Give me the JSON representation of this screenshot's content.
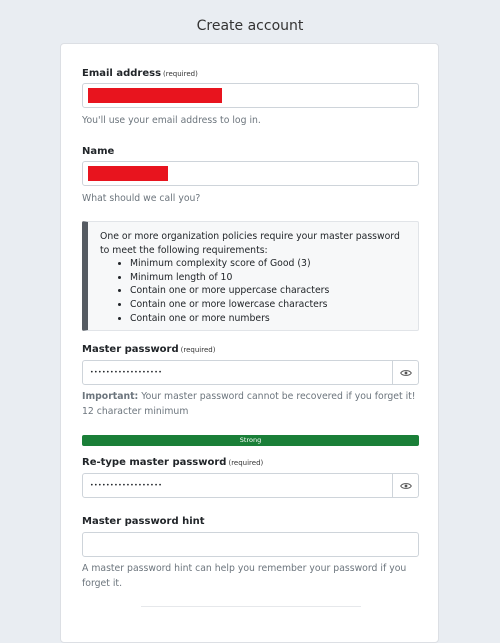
{
  "page": {
    "title": "Create account"
  },
  "form": {
    "email": {
      "label": "Email address",
      "required": "(required)",
      "help": "You'll use your email address to log in."
    },
    "name": {
      "label": "Name",
      "help": "What should we call you?"
    },
    "policy": {
      "intro": "One or more organization policies require your master password to meet the following requirements:",
      "items": [
        "Minimum complexity score of Good (3)",
        "Minimum length of 10",
        "Contain one or more uppercase characters",
        "Contain one or more lowercase characters",
        "Contain one or more numbers"
      ]
    },
    "master_password": {
      "label": "Master password",
      "required": "(required)",
      "value": "••••••••••••••••••",
      "help_strong": "Important:",
      "help": " Your master password cannot be recovered if you forget it! 12 character minimum"
    },
    "strength": {
      "label": "Strong",
      "color": "#1a7f38"
    },
    "retype_password": {
      "label": "Re-type master password",
      "required": "(required)",
      "value": "••••••••••••••••••"
    },
    "hint": {
      "label": "Master password hint",
      "value": "",
      "help": "A master password hint can help you remember your password if you forget it."
    }
  },
  "icons": {
    "toggle_visibility": "eye-icon"
  },
  "colors": {
    "redaction": "#e8141e",
    "policy_border": "#555b62"
  }
}
